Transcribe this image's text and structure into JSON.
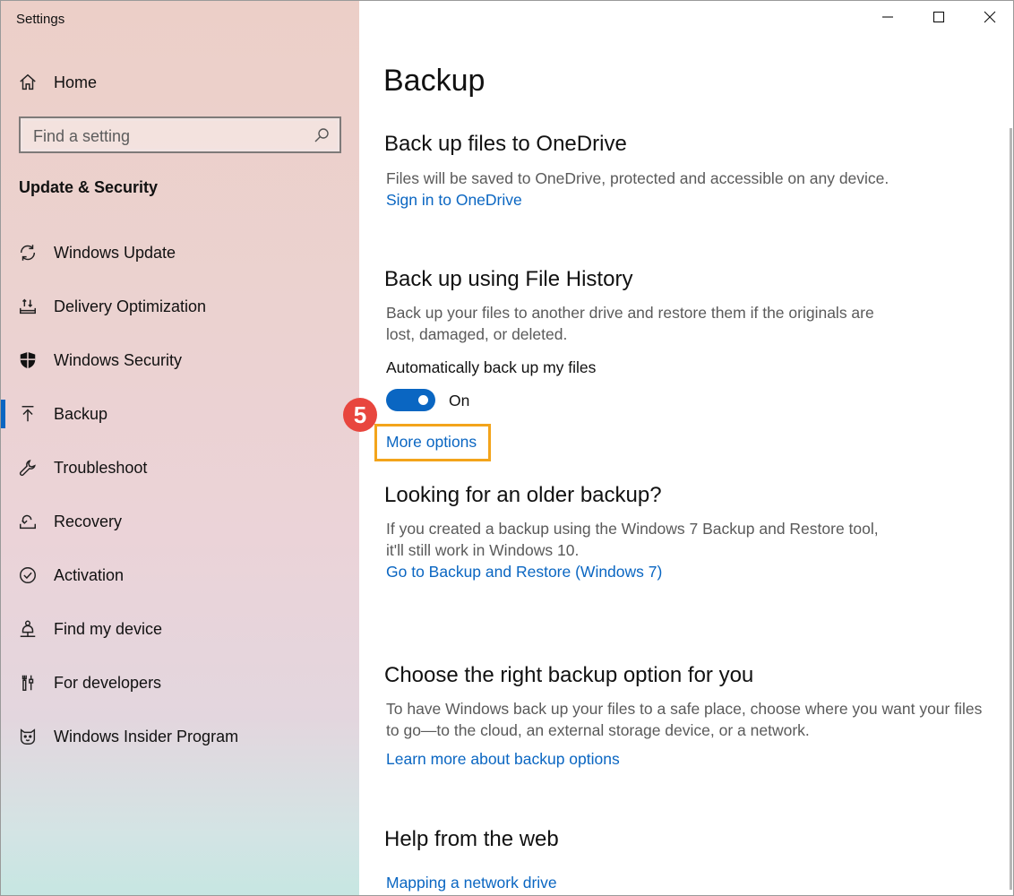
{
  "window": {
    "title": "Settings",
    "controls": {
      "minimize": "minimize-icon",
      "maximize": "maximize-icon",
      "close": "close-icon"
    }
  },
  "sidebar": {
    "home_label": "Home",
    "search_placeholder": "Find a setting",
    "section_title": "Update & Security",
    "items": [
      {
        "label": "Windows Update",
        "icon": "refresh-icon"
      },
      {
        "label": "Delivery Optimization",
        "icon": "delivery-icon"
      },
      {
        "label": "Windows Security",
        "icon": "shield-icon"
      },
      {
        "label": "Backup",
        "icon": "upload-arrow-icon",
        "selected": true
      },
      {
        "label": "Troubleshoot",
        "icon": "wrench-icon"
      },
      {
        "label": "Recovery",
        "icon": "recovery-icon"
      },
      {
        "label": "Activation",
        "icon": "check-circle-icon"
      },
      {
        "label": "Find my device",
        "icon": "person-location-icon"
      },
      {
        "label": "For developers",
        "icon": "developer-tools-icon"
      },
      {
        "label": "Windows Insider Program",
        "icon": "cat-icon"
      }
    ]
  },
  "main": {
    "title": "Backup",
    "onedrive": {
      "heading": "Back up files to OneDrive",
      "description": "Files will be saved to OneDrive, protected and accessible on any device.",
      "link": "Sign in to OneDrive"
    },
    "file_history": {
      "heading": "Back up using File History",
      "description_line1": "Back up your files to another drive and restore them if the originals are",
      "description_line2": "lost, damaged, or deleted.",
      "toggle_label": "Automatically back up my files",
      "toggle_state": "On",
      "more_options": "More options"
    },
    "older_backup": {
      "heading": "Looking for an older backup?",
      "description_line1": "If you created a backup using the Windows 7 Backup and Restore tool,",
      "description_line2": "it'll still work in Windows 10.",
      "link": "Go to Backup and Restore (Windows 7)"
    },
    "right_option": {
      "heading": "Choose the right backup option for you",
      "description_line1": "To have Windows back up your files to a safe place, choose where you want your files",
      "description_line2": "to go—to the cloud, an external storage device, or a network.",
      "link": "Learn more about backup options"
    },
    "help": {
      "heading": "Help from the web",
      "link": "Mapping a network drive"
    }
  },
  "annotation": {
    "step_number": "5",
    "highlight_color": "#f3a41b",
    "badge_color": "#e8463e"
  },
  "colors": {
    "accent": "#0a66c2"
  }
}
